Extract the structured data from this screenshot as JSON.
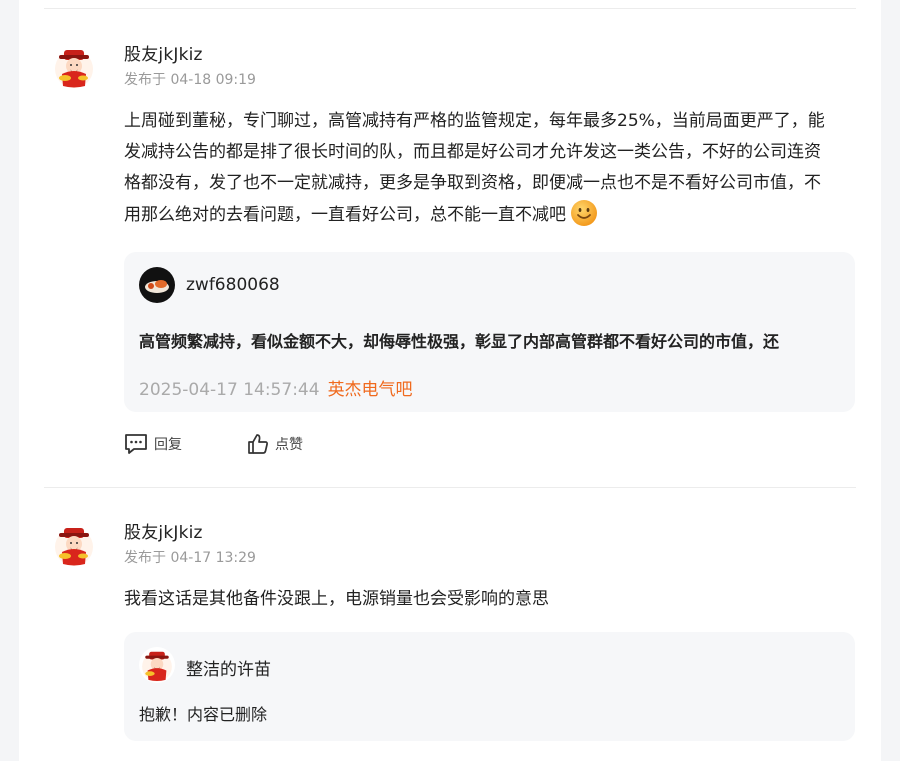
{
  "colors": {
    "accent": "#f06a1e",
    "meta_gray": "#9a9a9a",
    "card_bg": "#f6f7f9"
  },
  "posts": [
    {
      "username": "股友jkJkiz",
      "meta": "发布于 04-18 09:19",
      "content_lines": [
        "上周碰到董秘，专门聊过，高管减持有严格的监管规定，每年最多25%，当前局面更严了，能",
        "发减持公告的都是排了很长时间的队，而且都是好公司才允许发这一类公告，不好的公司连资",
        "格都没有，发了也不一定就减持，更多是争取到资格，即便减一点也不是不看好公司市值，不",
        "用那么绝对的去看问题，一直看好公司，总不能一直不减吧"
      ],
      "emoji": "smile-emoji",
      "reply": {
        "username": "zwf680068",
        "text": "高管频繁减持，看似金额不大，却侮辱性极强，彰显了内部高管群都不看好公司的市值，还",
        "time": "2025-04-17 14:57:44",
        "source": "英杰电气吧"
      },
      "actions": {
        "reply_label": "回复",
        "like_label": "点赞"
      }
    },
    {
      "username": "股友jkJkiz",
      "meta": "发布于 04-17 13:29",
      "content": "我看这话是其他备件没跟上，电源销量也会受影响的意思",
      "reply": {
        "username": "整洁的许苗",
        "text": "抱歉！内容已删除"
      }
    }
  ]
}
